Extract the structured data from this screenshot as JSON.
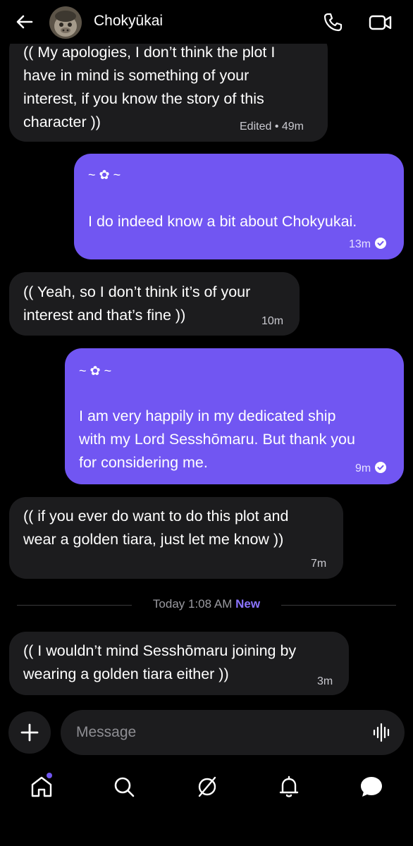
{
  "header": {
    "contact_name": "Chokyūkai"
  },
  "messages": [
    {
      "direction": "in",
      "text_lines": [
        "(( My apologies, I don’t think the plot I",
        "have in mind is something of your",
        "interest, if you know the story of this",
        "character ))"
      ],
      "meta": "Edited • 49m"
    },
    {
      "direction": "out",
      "decoration": "~ ✿ ~",
      "text": "I do indeed know a bit about Chokyukai.",
      "time": "13m"
    },
    {
      "direction": "in",
      "text_lines": [
        "(( Yeah, so I don’t think it’s of your",
        "interest and that’s fine ))"
      ],
      "time": "10m"
    },
    {
      "direction": "out",
      "decoration": "~ ✿ ~",
      "text_lines": [
        "I am very happily in my dedicated ship",
        "with my Lord Sesshōmaru. But thank you",
        "for considering me."
      ],
      "time": "9m"
    },
    {
      "direction": "in",
      "text_lines": [
        "(( if you ever do want to do this plot and",
        "wear a golden tiara, just let me know ))"
      ],
      "time": "7m"
    },
    {
      "direction": "in",
      "text_lines": [
        "(( I wouldn’t mind Sesshōmaru joining by",
        "wearing a golden tiara either ))"
      ],
      "time": "3m"
    }
  ],
  "divider": {
    "label": "Today 1:08 AM",
    "new_label": "New"
  },
  "composer": {
    "placeholder": "Message"
  },
  "tabbar": {
    "icons": [
      "home-icon",
      "search-icon",
      "explore-icon",
      "notifications-icon",
      "messages-icon"
    ]
  },
  "colors": {
    "background": "#000000",
    "incoming_bubble": "#1c1c1e",
    "outgoing_bubble": "#7156f2",
    "new_label": "#8b74ff"
  }
}
